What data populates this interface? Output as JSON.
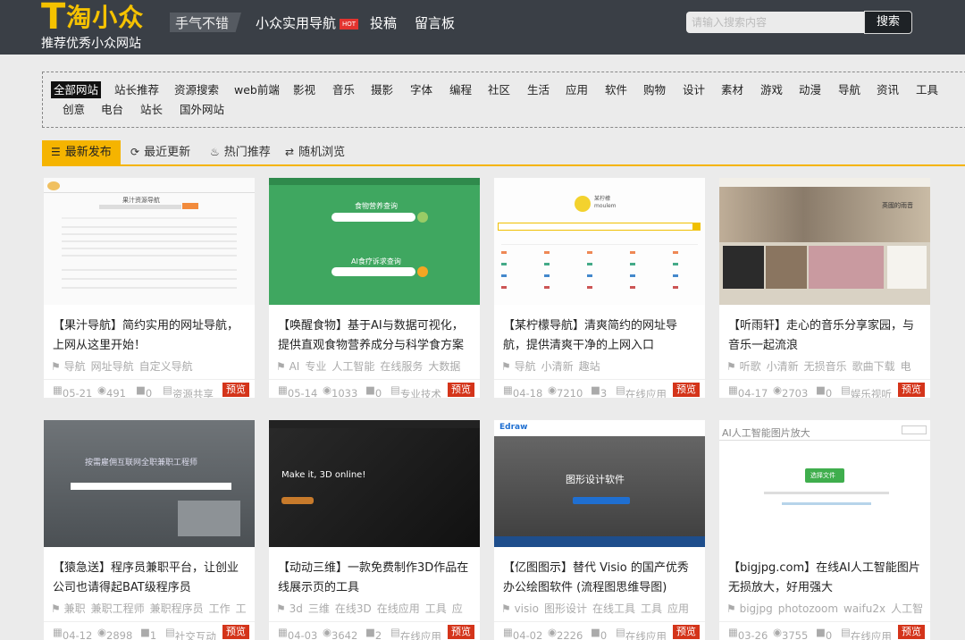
{
  "header": {
    "logo_text": "淘小众",
    "logo_sub": "推荐优秀小众网站",
    "nav": [
      {
        "label": "手气不错"
      },
      {
        "label": "小众实用导航",
        "badge": "HOT"
      },
      {
        "label": "投稿"
      },
      {
        "label": "留言板"
      }
    ],
    "search_placeholder": "请输入搜索内容",
    "search_button": "搜索"
  },
  "categories": [
    "全部网站",
    "站长推荐",
    "资源搜索",
    "web前端",
    "影视",
    "音乐",
    "摄影",
    "字体",
    "编程",
    "社区",
    "生活",
    "应用",
    "软件",
    "购物",
    "设计",
    "素材",
    "游戏",
    "动漫",
    "导航",
    "资讯",
    "工具",
    "创意",
    "电台",
    "站长",
    "国外网站"
  ],
  "tabs": [
    {
      "label": "最新发布",
      "icon": "list-icon"
    },
    {
      "label": "最近更新",
      "icon": "refresh-icon"
    },
    {
      "label": "热门推荐",
      "icon": "fire-icon"
    },
    {
      "label": "随机浏览",
      "icon": "shuffle-icon"
    }
  ],
  "cards": [
    {
      "title": "【果汁导航】简约实用的网址导航，上网从这里开始！",
      "tags": [
        "导航",
        "网址导航",
        "自定义导航"
      ],
      "date": "05-21",
      "views": "491",
      "comments": "0",
      "category": "资源共享",
      "preview": "预览",
      "thumb": {
        "heading": "果汁资源导航"
      }
    },
    {
      "title": "【唤醒食物】基于AI与数据可视化，提供直观食物营养成分与科学食方案",
      "tags": [
        "AI",
        "专业",
        "人工智能",
        "在线服务",
        "大数据"
      ],
      "date": "05-14",
      "views": "1033",
      "comments": "0",
      "category": "专业技术",
      "preview": "预览",
      "thumb": {
        "heading": "食物营养查询",
        "heading2": "AI食疗诉求查询"
      }
    },
    {
      "title": "【某柠檬导航】清爽简约的网址导航，提供清爽干净的上网入口",
      "tags": [
        "导航",
        "小清新",
        "趣站"
      ],
      "date": "04-18",
      "views": "7210",
      "comments": "3",
      "category": "在线应用",
      "preview": "预览",
      "thumb": {
        "heading": "某柠檬",
        "heading2": "moulem"
      }
    },
    {
      "title": "【听雨轩】走心的音乐分享家园，与音乐一起流浪",
      "tags": [
        "听歌",
        "小清新",
        "无损音乐",
        "歌曲下载",
        "电"
      ],
      "date": "04-17",
      "views": "2703",
      "comments": "0",
      "category": "娱乐视听",
      "preview": "预览",
      "thumb": {
        "heading": "英國的雨音"
      }
    },
    {
      "title": "【猿急送】程序员兼职平台，让创业公司也请得起BAT级程序员",
      "tags": [
        "兼职",
        "兼职工程师",
        "兼职程序员",
        "工作",
        "工"
      ],
      "date": "04-12",
      "views": "2898",
      "comments": "1",
      "category": "社交互动",
      "preview": "预览",
      "thumb": {
        "heading": "按需雇佣互联网全职兼职工程师"
      }
    },
    {
      "title": "【动动三维】一款免费制作3D作品在线展示页的工具",
      "tags": [
        "3d",
        "三维",
        "在线3D",
        "在线应用",
        "工具",
        "应"
      ],
      "date": "04-03",
      "views": "3642",
      "comments": "2",
      "category": "在线应用",
      "preview": "预览",
      "thumb": {
        "heading": "Make it, 3D online!"
      }
    },
    {
      "title": "【亿图图示】替代 Visio 的国产优秀办公绘图软件 (流程图思维导图)",
      "tags": [
        "visio",
        "图形设计",
        "在线工具",
        "工具",
        "应用"
      ],
      "date": "04-02",
      "views": "2226",
      "comments": "0",
      "category": "在线应用",
      "preview": "预览",
      "thumb": {
        "logo": "Edraw",
        "heading": "图形设计软件"
      }
    },
    {
      "title": "【bigjpg.com】在线AI人工智能图片无损放大，好用强大",
      "tags": [
        "bigjpg",
        "photozoom",
        "waifu2x",
        "人工智"
      ],
      "date": "03-26",
      "views": "3755",
      "comments": "0",
      "category": "在线应用",
      "preview": "预览",
      "thumb": {
        "heading": "AI人工智能图片放大",
        "button": "选择文件"
      }
    }
  ]
}
